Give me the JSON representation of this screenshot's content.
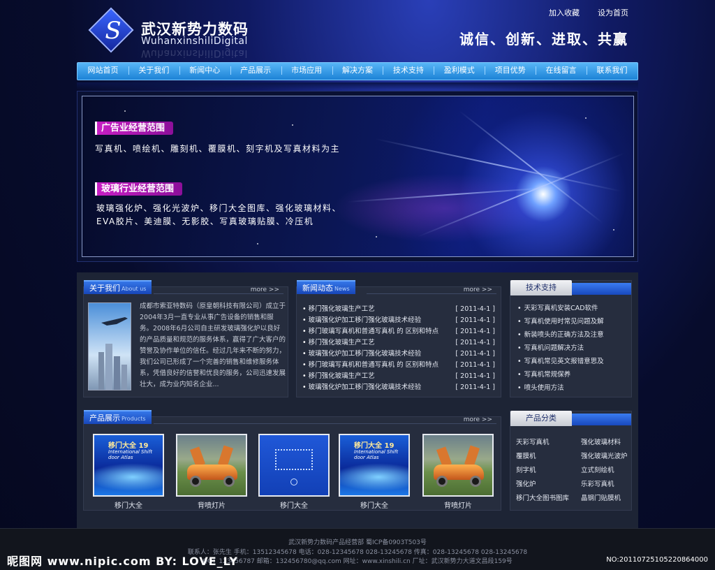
{
  "header": {
    "brand_cn": "武汉新势力数码",
    "brand_en": "WuhanxinshiliDigital",
    "top_links": [
      "加入收藏",
      "设为首页"
    ],
    "slogan": "诚信、创新、进取、共赢"
  },
  "nav": [
    "网站首页",
    "关于我们",
    "新闻中心",
    "产品展示",
    "市场应用",
    "解决方案",
    "技术支持",
    "盈利模式",
    "项目优势",
    "在线留言",
    "联系我们"
  ],
  "banner": {
    "tag1": "广告业经营范围",
    "text1": "写真机、喷绘机、雕刻机、覆膜机、刻字机及写真材料为主",
    "tag2": "玻璃行业经营范围",
    "text2a": "玻璃强化炉、强化光波炉、移门大全图库、强化玻璃材料、",
    "text2b": "EVA胶片、美迪膜、无影胶、写真玻璃贴膜、冷压机"
  },
  "about": {
    "title": "关于我们",
    "title_en": "About us",
    "more": "more >>",
    "text": "成都市索亚特数码（原皇朝科技有限公司）成立于 2004年3月一直专业从事广告设备的销售和服务。2008年6月公司自主研发玻璃强化炉以良好的产品质量和规范的服务体系，赢得了广大客户的赞誉及协作单位的信任。经过几年来不断的努力，我们公司已形成了一个完善的销售和维修服务体系，凭借良好的信誉和优良的服务，公司迅速发展壮大，成为业内知名企业..."
  },
  "news": {
    "title": "新闻动态",
    "title_en": "News",
    "more": "more >>",
    "items": [
      {
        "title": "移门强化玻璃生产工艺",
        "date": "[ 2011-4-1 ]"
      },
      {
        "title": "玻璃强化炉加工移门强化玻璃技术经验",
        "date": "[ 2011-4-1 ]"
      },
      {
        "title": "移门玻璃写真机和普通写真机 的 区别和特点",
        "date": "[ 2011-4-1 ]"
      },
      {
        "title": "移门强化玻璃生产工艺",
        "date": "[ 2011-4-1 ]"
      },
      {
        "title": "玻璃强化炉加工移门强化玻璃技术经验",
        "date": "[ 2011-4-1 ]"
      },
      {
        "title": "移门玻璃写真机和普通写真机 的 区别和特点",
        "date": "[ 2011-4-1 ]"
      },
      {
        "title": "移门强化玻璃生产工艺",
        "date": "[ 2011-4-1 ]"
      },
      {
        "title": "玻璃强化炉加工移门强化玻璃技术经验",
        "date": "[ 2011-4-1 ]"
      }
    ]
  },
  "tech": {
    "title": "技术支持",
    "items": [
      "天彩写真机安装CAD软件",
      "写真机使用时常见问题及解",
      "新装喷头的正确方法及注意",
      "写真机问题解决方法",
      "写真机常见英文报错意思及",
      "写真机常规保养",
      "喷头使用方法"
    ]
  },
  "products": {
    "title": "产品展示",
    "title_en": "Products",
    "more": "more >>",
    "book_title": "移门大全 19",
    "book_sub": "International Shift door Atlas",
    "items": [
      "移门大全",
      "背喷灯片",
      "移门大全",
      "移门大全",
      "背喷灯片"
    ]
  },
  "categories": {
    "title": "产品分类",
    "items": [
      "天彩写真机",
      "强化玻璃材料",
      "覆膜机",
      "强化玻璃光波炉",
      "刻字机",
      "立式刻绘机",
      "强化炉",
      "乐彩写真机",
      "移门大全图书图库",
      "晶钢门贴膜机"
    ]
  },
  "footer": {
    "line1": "武汉新势力数码产品经营部  蜀ICP备0903T503号",
    "line2": "联系人：张先生   手机：13512345678   电话：028-12345678   028-13245678   传真：028-13245678   028-13245678",
    "line3": "QQ：123456787   邮箱：132456780@qq.com   网址：www.xinshili.cn   厂址：武汉新势力大道文昌段159号"
  },
  "watermark": {
    "left": "昵图网 www.nipic.com  BY: LOVE_LY",
    "right": "NO:20110725105220864000"
  }
}
